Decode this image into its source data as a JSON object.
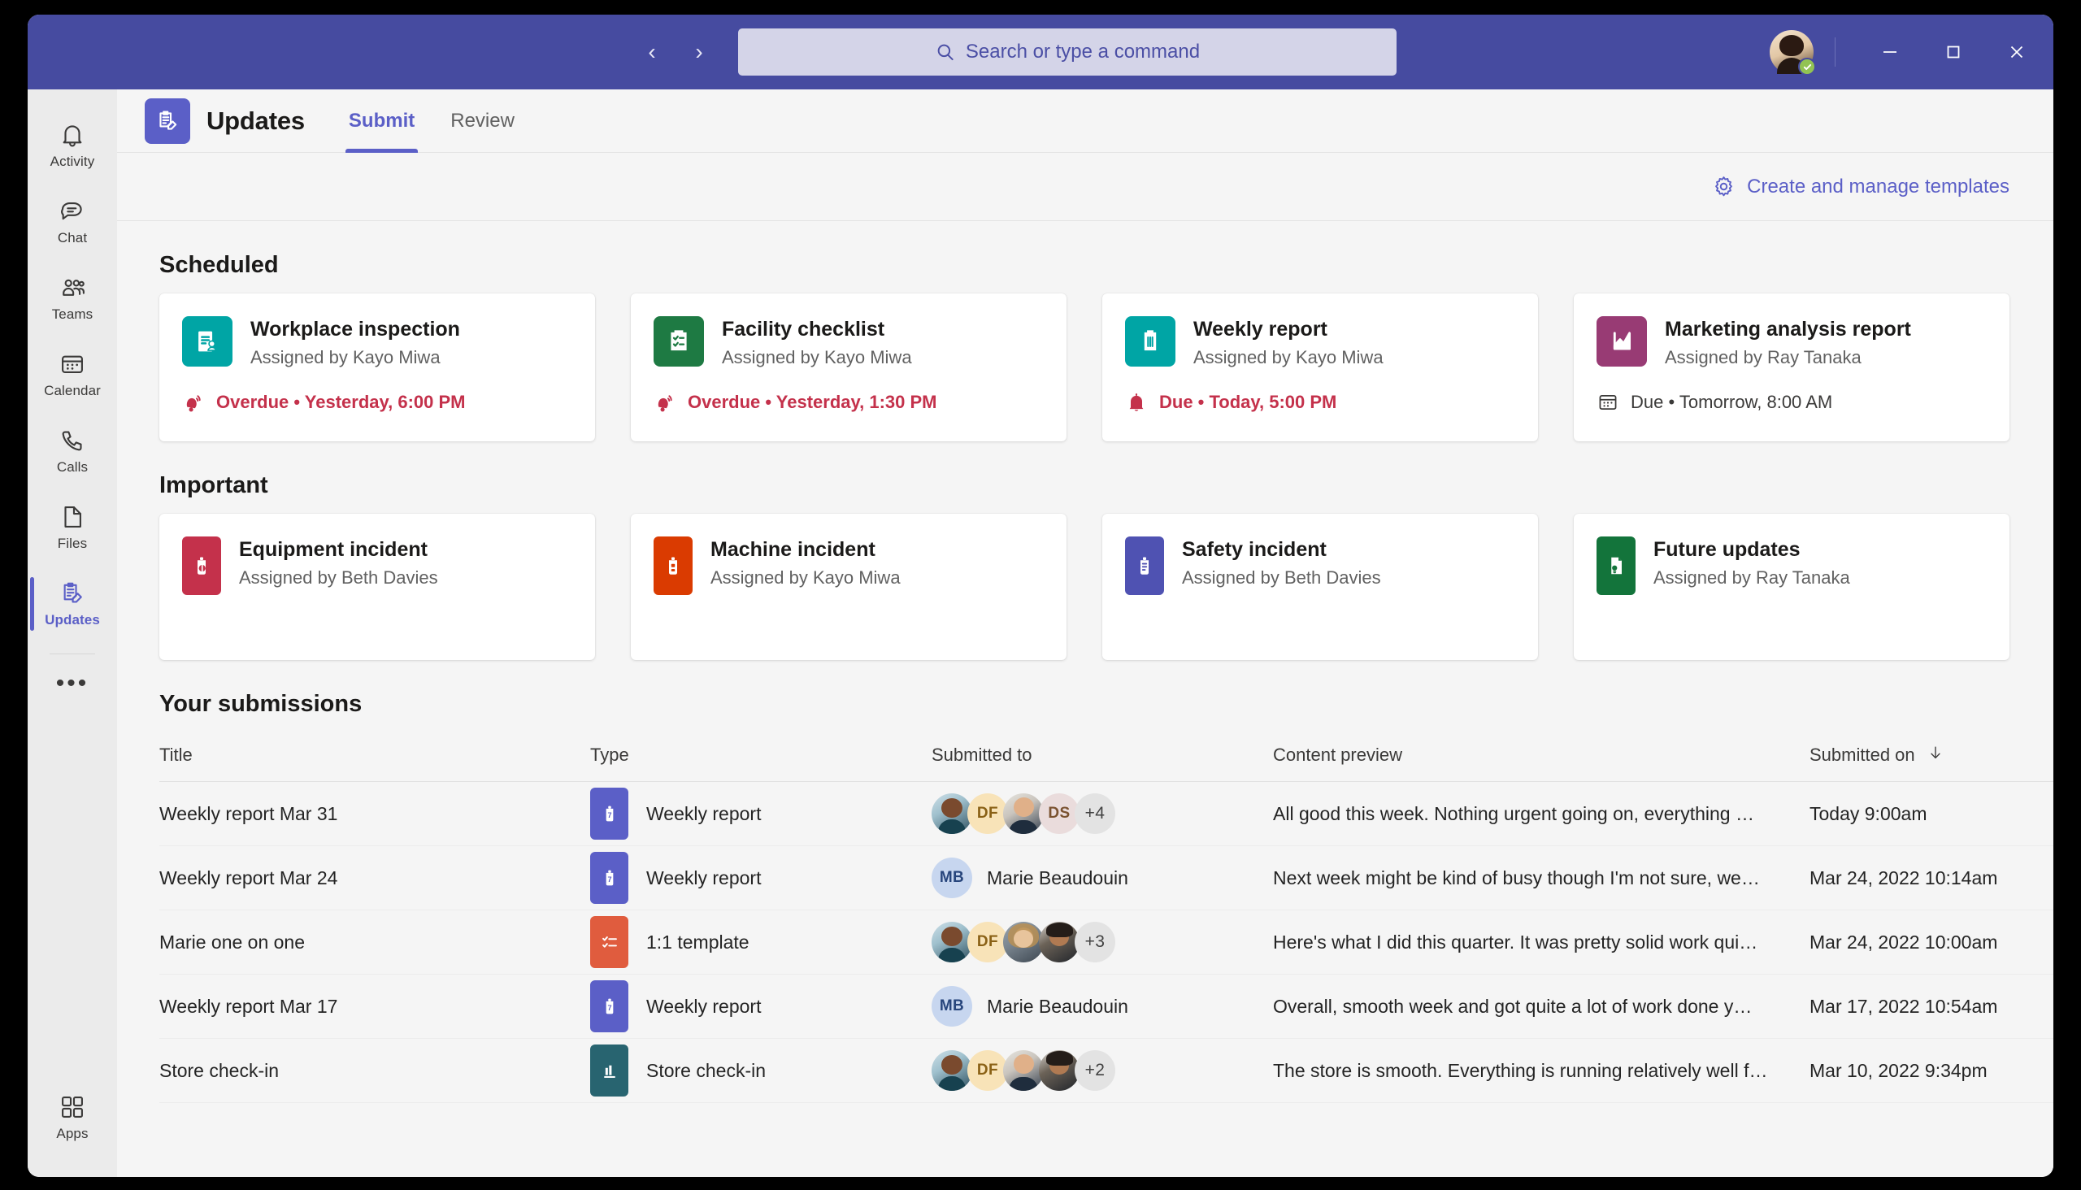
{
  "titlebar": {
    "back_icon": "chevron-left-icon",
    "forward_icon": "chevron-right-icon",
    "search_placeholder": "Search or type a command",
    "search_value": "",
    "minimize_label": "Minimize",
    "maximize_label": "Maximize",
    "close_label": "Close",
    "presence": "available",
    "brand_color": "#464ba0"
  },
  "rail": {
    "items": [
      {
        "label": "Activity",
        "icon": "bell-icon",
        "active": false
      },
      {
        "label": "Chat",
        "icon": "chat-icon",
        "active": false
      },
      {
        "label": "Teams",
        "icon": "teams-icon",
        "active": false
      },
      {
        "label": "Calendar",
        "icon": "calendar-icon",
        "active": false
      },
      {
        "label": "Calls",
        "icon": "phone-icon",
        "active": false
      },
      {
        "label": "Files",
        "icon": "file-icon",
        "active": false
      },
      {
        "label": "Updates",
        "icon": "updates-icon",
        "active": true
      }
    ],
    "more_label": "•••",
    "apps_label": "Apps",
    "accent_color": "#5b5fc7"
  },
  "header": {
    "app_title": "Updates",
    "app_icon": "updates-clipboard-icon",
    "tabs": [
      {
        "label": "Submit",
        "active": true
      },
      {
        "label": "Review",
        "active": false
      }
    ]
  },
  "toolbar": {
    "templates_label": "Create and manage templates",
    "templates_icon": "gear-icon"
  },
  "sections": [
    {
      "title": "Scheduled",
      "cards": [
        {
          "name": "Workplace inspection",
          "assigned": "Assigned by Kayo Miwa",
          "icon": "clipboard-person-icon",
          "icon_color": "#00a5a5",
          "due_state": "overdue",
          "due_icon": "bell-ringing-icon",
          "due_text": "Overdue • Yesterday, 6:00 PM"
        },
        {
          "name": "Facility checklist",
          "assigned": "Assigned by Kayo Miwa",
          "icon": "clipboard-checklist-icon",
          "icon_color": "#1e7a43",
          "due_state": "overdue",
          "due_icon": "bell-ringing-icon",
          "due_text": "Overdue • Yesterday, 1:30 PM"
        },
        {
          "name": "Weekly report",
          "assigned": "Assigned by Kayo Miwa",
          "icon": "clipboard-lines-icon",
          "icon_color": "#00a5a5",
          "due_state": "due",
          "due_icon": "bell-icon",
          "due_text": "Due • Today, 5:00 PM"
        },
        {
          "name": "Marketing analysis report",
          "assigned": "Assigned by Ray Tanaka",
          "icon": "chart-icon",
          "icon_color": "#983b74",
          "due_state": "normal",
          "due_icon": "calendar-icon",
          "due_text": "Due • Tomorrow, 8:00 AM"
        }
      ]
    },
    {
      "title": "Important",
      "cards": [
        {
          "name": "Equipment incident",
          "assigned": "Assigned by Beth Davies",
          "icon": "equipment-icon",
          "icon_color": "#c4314b"
        },
        {
          "name": "Machine incident",
          "assigned": "Assigned by Kayo Miwa",
          "icon": "machine-icon",
          "icon_color": "#da3b01"
        },
        {
          "name": "Safety incident",
          "assigned": "Assigned by Beth Davies",
          "icon": "safety-icon",
          "icon_color": "#4f52b2"
        },
        {
          "name": "Future updates",
          "assigned": "Assigned by Ray Tanaka",
          "icon": "document-idea-icon",
          "icon_color": "#13743b"
        }
      ]
    }
  ],
  "submissions": {
    "title": "Your submissions",
    "columns": [
      {
        "label": "Title",
        "sorted": false
      },
      {
        "label": "Type",
        "sorted": false
      },
      {
        "label": "Submitted to",
        "sorted": false
      },
      {
        "label": "Content preview",
        "sorted": false
      },
      {
        "label": "Submitted on",
        "sorted": true,
        "sort_icon": "arrow-down-icon"
      }
    ],
    "rows": [
      {
        "title": "Weekly report Mar 31",
        "type": "Weekly report",
        "type_icon": "clipboard-7-icon",
        "type_color": "#5b5fc7",
        "avatars": [
          {
            "kind": "photo",
            "tone": "man-teal"
          },
          {
            "kind": "initials",
            "text": "DF",
            "bg": "#f8e3b8",
            "fg": "#8a6116"
          },
          {
            "kind": "photo",
            "tone": "woman-glasses"
          },
          {
            "kind": "initials",
            "text": "DS",
            "bg": "#eadcdc",
            "fg": "#7a5230"
          }
        ],
        "overflow": "+4",
        "named": null,
        "preview": "All good this week. Nothing urgent going on, everything …",
        "submitted_on": "Today 9:00am"
      },
      {
        "title": "Weekly report Mar 24",
        "type": "Weekly report",
        "type_icon": "clipboard-7-icon",
        "type_color": "#5b5fc7",
        "avatars": [
          {
            "kind": "initials",
            "text": "MB",
            "bg": "#c7d6ef",
            "fg": "#27457c"
          }
        ],
        "overflow": null,
        "named": "Marie Beaudouin",
        "preview": "Next week might be kind of busy though I'm not sure, we…",
        "submitted_on": "Mar 24, 2022 10:14am"
      },
      {
        "title": "Marie one on one",
        "type": "1:1 template",
        "type_icon": "checklist-icon",
        "type_color": "#e05c3e",
        "avatars": [
          {
            "kind": "photo",
            "tone": "man-teal"
          },
          {
            "kind": "initials",
            "text": "DF",
            "bg": "#f8e3b8",
            "fg": "#8a6116"
          },
          {
            "kind": "photo",
            "tone": "woman-blonde"
          },
          {
            "kind": "photo",
            "tone": "man-dark"
          }
        ],
        "overflow": "+3",
        "named": null,
        "preview": "Here's what I did this quarter. It was pretty solid work qui…",
        "submitted_on": "Mar 24, 2022 10:00am"
      },
      {
        "title": "Weekly report Mar 17",
        "type": "Weekly report",
        "type_icon": "clipboard-7-icon",
        "type_color": "#5b5fc7",
        "avatars": [
          {
            "kind": "initials",
            "text": "MB",
            "bg": "#c7d6ef",
            "fg": "#27457c"
          }
        ],
        "overflow": null,
        "named": "Marie Beaudouin",
        "preview": "Overall, smooth week and got quite a lot of work done y…",
        "submitted_on": "Mar 17, 2022 10:54am"
      },
      {
        "title": "Store check-in",
        "type": "Store check-in",
        "type_icon": "store-chart-icon",
        "type_color": "#286470",
        "avatars": [
          {
            "kind": "photo",
            "tone": "man-teal"
          },
          {
            "kind": "initials",
            "text": "DF",
            "bg": "#f8e3b8",
            "fg": "#8a6116"
          },
          {
            "kind": "photo",
            "tone": "woman-glasses"
          },
          {
            "kind": "photo",
            "tone": "man-dark"
          }
        ],
        "overflow": "+2",
        "named": null,
        "preview": "The store is smooth. Everything is running relatively well f…",
        "submitted_on": "Mar 10, 2022 9:34pm"
      }
    ]
  }
}
